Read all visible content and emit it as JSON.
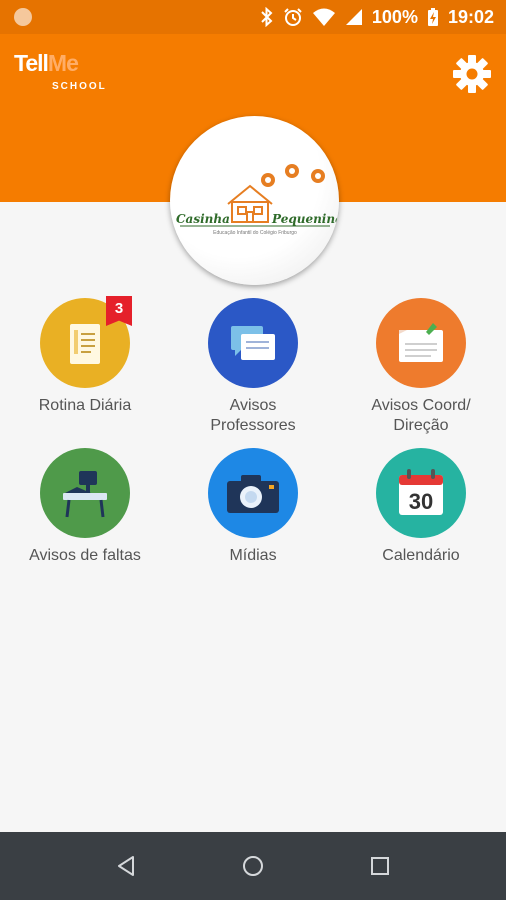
{
  "status_bar": {
    "battery": "100%",
    "time": "19:02",
    "icons": [
      "bluetooth-icon",
      "alarm-icon",
      "wifi-icon",
      "signal-icon",
      "battery-charging-icon"
    ]
  },
  "header": {
    "logo_main": "Tell",
    "logo_accent": "Me",
    "logo_sub": "SCHOOL",
    "settings_icon": "gear-icon",
    "color": "#f57c00"
  },
  "school": {
    "name_left": "Casinha",
    "name_right": "Pequenina",
    "caption": "Educação Infantil do Colégio Friburgo"
  },
  "menu": [
    {
      "label": "Rotina Diária",
      "color": "#e9b024",
      "icon": "daily-routine-icon",
      "badge": "3"
    },
    {
      "label": "Avisos Professores",
      "color": "#2b58c6",
      "icon": "chat-icon"
    },
    {
      "label": "Avisos Coord/ Direção",
      "color": "#ee7b2d",
      "icon": "notice-icon"
    },
    {
      "label": "Avisos de faltas",
      "color": "#4f9a4a",
      "icon": "school-desk-icon"
    },
    {
      "label": "Mídias",
      "color": "#1e88e5",
      "icon": "camera-icon"
    },
    {
      "label": "Calendário",
      "color": "#26b3a1",
      "icon": "calendar-icon",
      "calendar_day": "30"
    }
  ],
  "nav": {
    "back": "back-icon",
    "home": "home-icon",
    "recents": "recents-icon"
  }
}
